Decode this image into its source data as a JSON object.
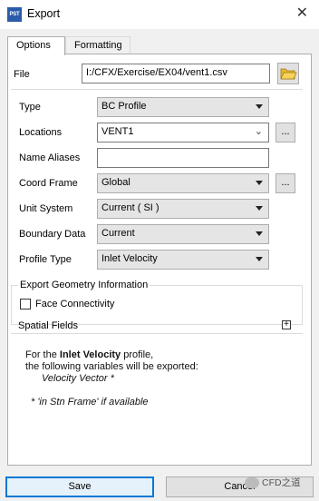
{
  "window": {
    "icon_text": "PST",
    "title": "Export",
    "close_glyph": "✕"
  },
  "tabs": [
    {
      "label": "Options",
      "active": true
    },
    {
      "label": "Formatting",
      "active": false
    }
  ],
  "file": {
    "label": "File",
    "value": "I:/CFX/Exercise/EX04/vent1.csv",
    "browse_icon": "folder-open-icon"
  },
  "rows": {
    "type": {
      "label": "Type",
      "value": "BC Profile"
    },
    "locations": {
      "label": "Locations",
      "value": "VENT1",
      "button": "..."
    },
    "name_aliases": {
      "label": "Name Aliases",
      "value": ""
    },
    "coord_frame": {
      "label": "Coord Frame",
      "value": "Global",
      "button": "..."
    },
    "unit_system": {
      "label": "Unit System",
      "value": "Current ( SI )"
    },
    "boundary_data": {
      "label": "Boundary Data",
      "value": "Current"
    },
    "profile_type": {
      "label": "Profile Type",
      "value": "Inlet Velocity"
    }
  },
  "geometry": {
    "title": "Export Geometry Information",
    "face_connectivity_label": "Face Connectivity",
    "face_connectivity_checked": false
  },
  "spatial_fields": {
    "label": "Spatial Fields",
    "expand_glyph": "+"
  },
  "info": {
    "line1_prefix": "For the ",
    "line1_bold": "Inlet Velocity",
    "line1_suffix": " profile,",
    "line2": "the following variables will be exported:",
    "line3": "Velocity Vector *",
    "footnote": "* 'in Stn Frame' if available"
  },
  "buttons": {
    "save": "Save",
    "cancel": "Cancel"
  },
  "watermark": {
    "text": "CFD之道"
  },
  "colors": {
    "accent": "#0078d7",
    "folder": "#f5c542"
  }
}
